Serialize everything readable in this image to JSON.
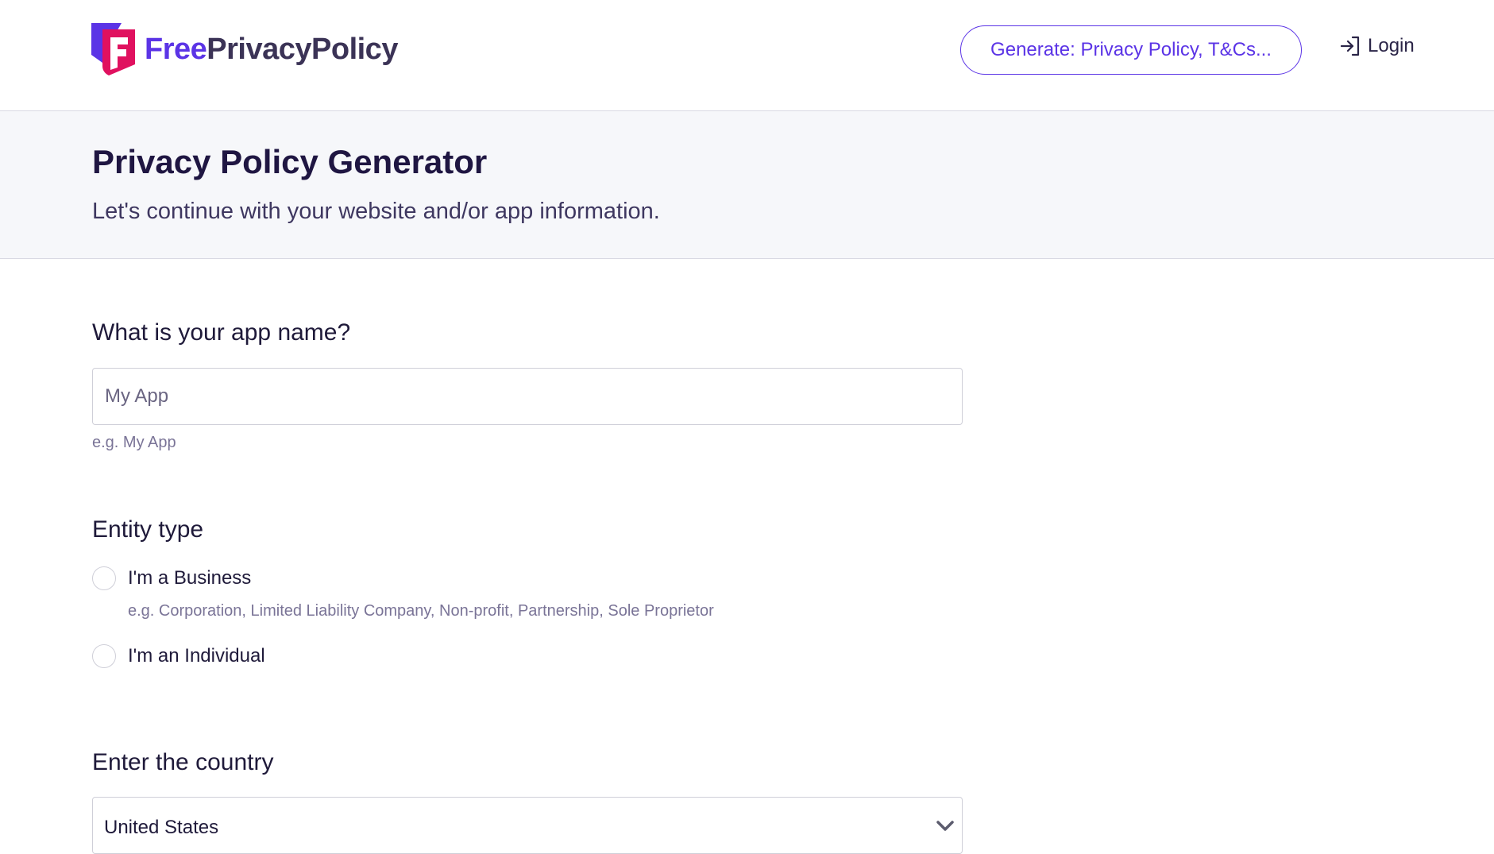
{
  "header": {
    "brand_free": "Free",
    "brand_rest": "PrivacyPolicy",
    "generate_label": "Generate: Privacy Policy, T&Cs...",
    "login_label": "Login"
  },
  "hero": {
    "title": "Privacy Policy Generator",
    "subtitle": "Let's continue with your website and/or app information."
  },
  "form": {
    "app_name": {
      "question": "What is your app name?",
      "placeholder": "My App",
      "value": "",
      "hint": "e.g. My App"
    },
    "entity": {
      "question": "Entity type",
      "options": [
        {
          "label": "I'm a Business",
          "hint": "e.g. Corporation, Limited Liability Company, Non-profit, Partnership, Sole Proprietor",
          "selected": false
        },
        {
          "label": "I'm an Individual",
          "selected": false
        }
      ]
    },
    "country": {
      "question": "Enter the country",
      "selected_value": "United States"
    }
  },
  "colors": {
    "brand_purple": "#5b34e6",
    "brand_pink": "#e0115f",
    "hero_bg": "#f6f7fa"
  },
  "icons": {
    "logo": "free-privacy-policy-logo",
    "login": "login-arrow-icon",
    "select": "chevron-down-icon"
  }
}
